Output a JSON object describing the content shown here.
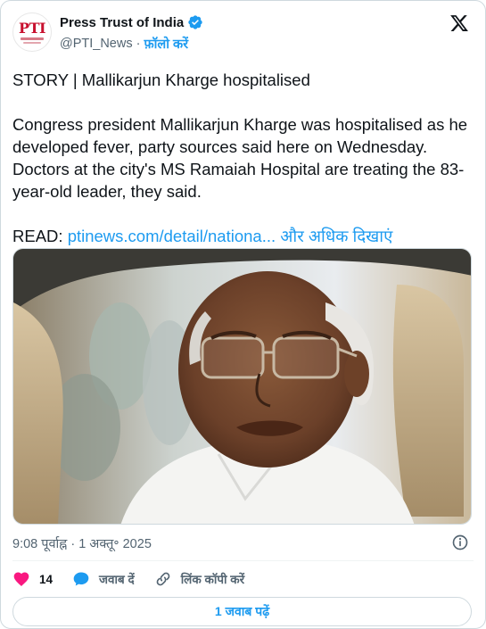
{
  "account": {
    "name": "Press Trust of India",
    "handle": "@PTI_News",
    "separator": "·",
    "follow_label": "फ़ॉलो करें",
    "avatar_text": "PTI"
  },
  "post": {
    "headline": "STORY | Mallikarjun Kharge hospitalised",
    "body": "Congress president Mallikarjun Kharge was hospitalised as he developed fever, party sources said here on Wednesday. Doctors at the city's MS Ramaiah Hospital are treating the 83-year-old leader, they said.",
    "read_prefix": "READ: ",
    "link_text": "ptinews.com/detail/nationa...",
    "show_more": "और अधिक दिखाएं"
  },
  "meta": {
    "timestamp": "9:08 पूर्वाह्न · 1 अक्तू॰ 2025"
  },
  "actions": {
    "like_count": "14",
    "reply_label": "जवाब दें",
    "copy_link_label": "लिंक कॉपी करें"
  },
  "replies_button": "1 जवाब पढ़ें",
  "colors": {
    "accent": "#1d9bf0",
    "like": "#f91880",
    "text": "#0f1419",
    "muted": "#536471",
    "border": "#cfd9de"
  },
  "icons": [
    "verified-badge-icon",
    "x-logo-icon",
    "info-icon",
    "heart-icon",
    "reply-bubble-icon",
    "link-icon"
  ]
}
